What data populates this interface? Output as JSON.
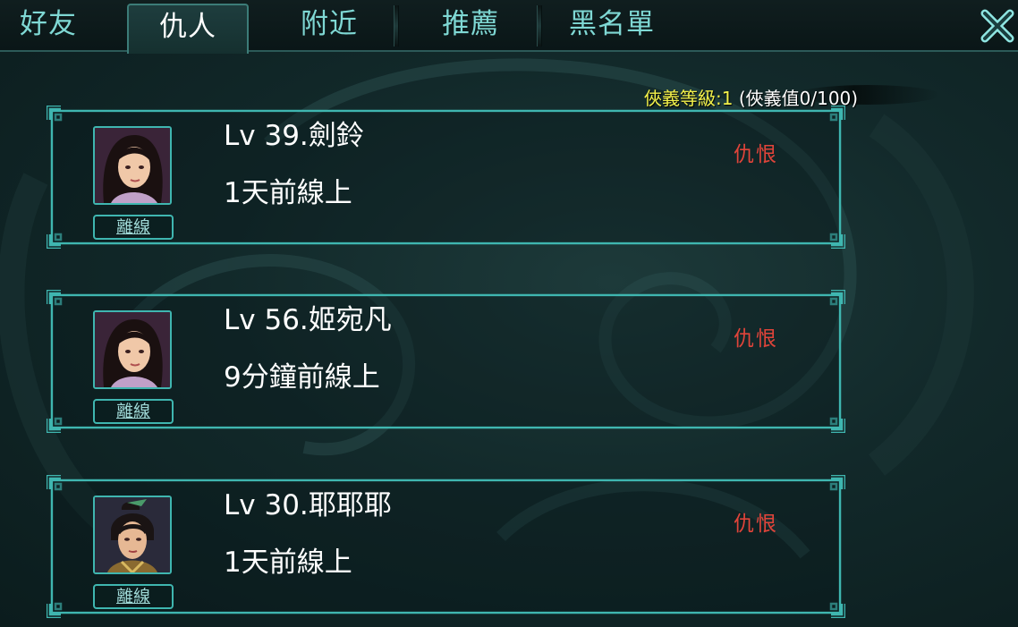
{
  "tabs": [
    {
      "label": "好友",
      "active": false
    },
    {
      "label": "仇人",
      "active": true
    },
    {
      "label": "附近",
      "active": false
    },
    {
      "label": "推薦",
      "active": false
    },
    {
      "label": "黑名單",
      "active": false
    }
  ],
  "icons": {
    "close": "close-icon"
  },
  "level": {
    "label": "俠義等級:",
    "value": "1",
    "detail": "(俠義值0/100)"
  },
  "colors": {
    "accent": "#3fb6b0",
    "tab_text": "#7fd8d4",
    "relation": "#e0443a",
    "level_highlight": "#f2f04a"
  },
  "enemies": [
    {
      "name": "Lv 39.劍鈴",
      "online": "1天前線上",
      "status": "離線",
      "relation": "仇恨",
      "avatar": "female-avatar"
    },
    {
      "name": "Lv 56.姬宛凡",
      "online": "9分鐘前線上",
      "status": "離線",
      "relation": "仇恨",
      "avatar": "female-avatar"
    },
    {
      "name": "Lv 30.耶耶耶",
      "online": "1天前線上",
      "status": "離線",
      "relation": "仇恨",
      "avatar": "male-avatar"
    }
  ]
}
